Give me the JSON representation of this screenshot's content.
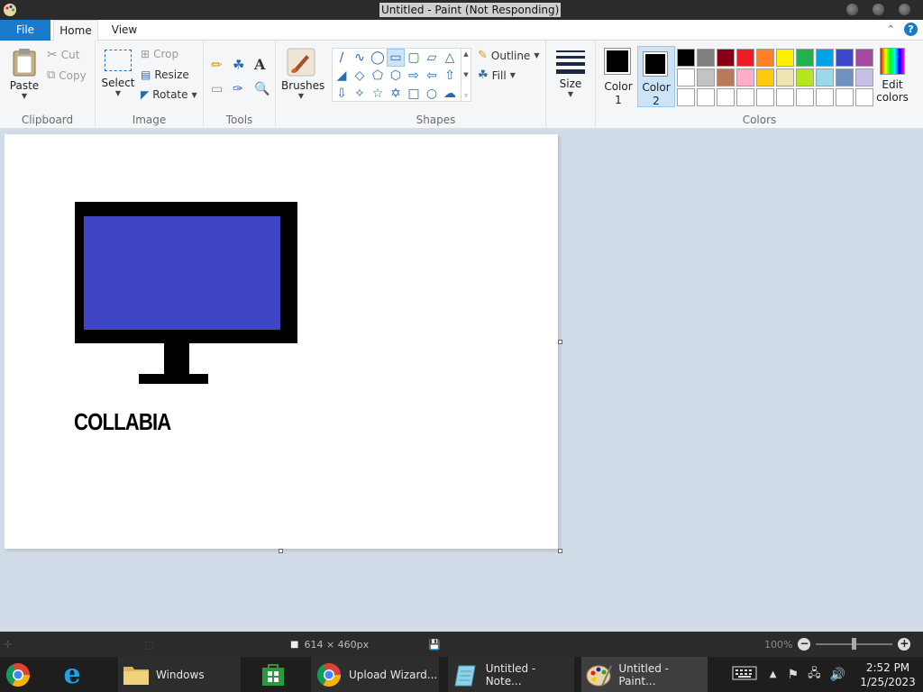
{
  "window": {
    "title": "Untitled - Paint (Not Responding)"
  },
  "tabs": {
    "file": "File",
    "home": "Home",
    "view": "View"
  },
  "clipboard": {
    "paste": "Paste",
    "cut": "Cut",
    "copy": "Copy",
    "label": "Clipboard"
  },
  "image": {
    "select": "Select",
    "crop": "Crop",
    "resize": "Resize",
    "rotate": "Rotate",
    "label": "Image"
  },
  "tools": {
    "label": "Tools"
  },
  "brushes": {
    "label": "Brushes"
  },
  "shapes": {
    "outline": "Outline",
    "fill": "Fill",
    "label": "Shapes"
  },
  "size": {
    "label": "Size"
  },
  "colors": {
    "color1_line1": "Color",
    "color1_line2": "1",
    "color2_line1": "Color",
    "color2_line2": "2",
    "edit_line1": "Edit",
    "edit_line2": "colors",
    "label": "Colors",
    "palette": [
      "#000000",
      "#7f7f7f",
      "#880015",
      "#ed1c24",
      "#ff7f27",
      "#fff200",
      "#22b14c",
      "#00a2e8",
      "#3f48cc",
      "#a349a4",
      "#ffffff",
      "#c3c3c3",
      "#b97a57",
      "#ffaec9",
      "#ffc90e",
      "#efe4b0",
      "#b5e61d",
      "#99d9ea",
      "#7092be",
      "#c8bfe7",
      "#ffffff",
      "#ffffff",
      "#ffffff",
      "#ffffff",
      "#ffffff",
      "#ffffff",
      "#ffffff",
      "#ffffff",
      "#ffffff",
      "#ffffff"
    ]
  },
  "canvas": {
    "text": "COLLABIA",
    "screen_color": "#3f46c6"
  },
  "status": {
    "dimensions": "614 × 460px",
    "zoom": "100%"
  },
  "taskbar": {
    "items": [
      {
        "label": "Windows"
      },
      {
        "label": "Upload Wizard..."
      },
      {
        "label": "Untitled - Note..."
      },
      {
        "label": "Untitled - Paint..."
      }
    ],
    "time": "2:52 PM",
    "date": "1/25/2023"
  }
}
